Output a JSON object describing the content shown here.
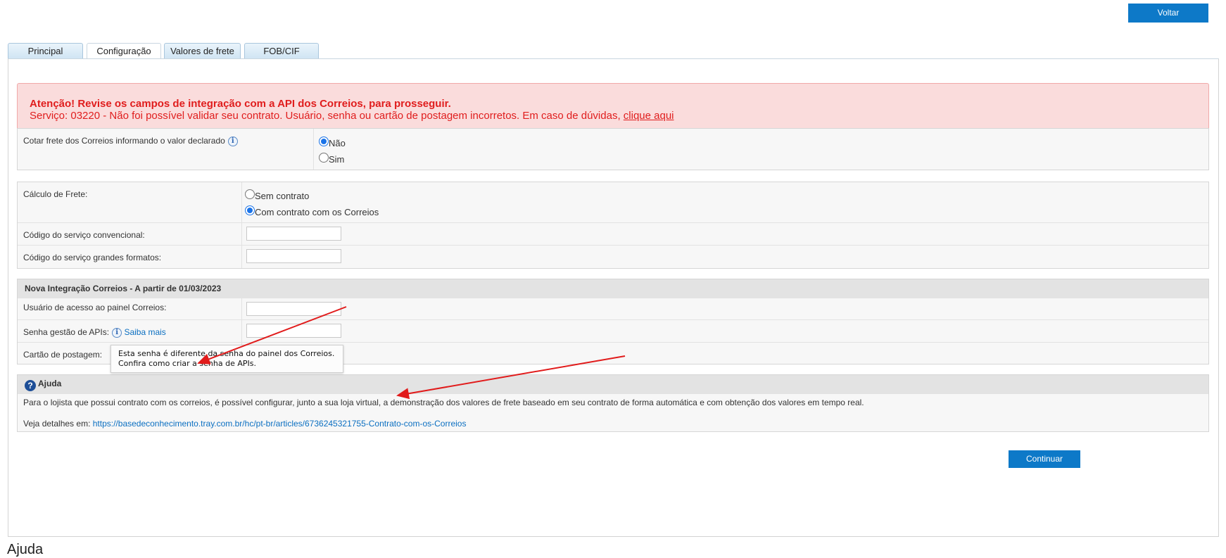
{
  "header": {
    "back_label": "Voltar"
  },
  "tabs": [
    {
      "label": "Principal"
    },
    {
      "label": "Configuração",
      "active": true
    },
    {
      "label": "Valores de frete"
    },
    {
      "label": "FOB/CIF"
    }
  ],
  "alert": {
    "title": "Atenção! Revise os campos de integração com a API dos Correios, para prosseguir.",
    "detail": "Serviço: 03220 - Não foi possível validar seu contrato. Usuário, senha ou cartão de postagem incorretos. Em caso de dúvidas, ",
    "link_label": "clique aqui"
  },
  "declared_value": {
    "label": "Cotar frete dos Correios informando o valor declarado",
    "options": [
      {
        "label": "Não",
        "selected": true
      },
      {
        "label": "Sim",
        "selected": false
      }
    ]
  },
  "freight": {
    "calc_label": "Cálculo de Frete:",
    "options": [
      {
        "label": "Sem contrato",
        "selected": false
      },
      {
        "label": "Com contrato com os Correios",
        "selected": true
      }
    ],
    "conventional_label": "Código do serviço convencional:",
    "conventional_value": "",
    "large_label": "Código do serviço grandes formatos:",
    "large_value": ""
  },
  "integration": {
    "title": "Nova Integração Correios - A partir de 01/03/2023",
    "user_label": "Usuário de acesso ao painel Correios:",
    "user_value": "",
    "password_label": "Senha gestão de APIs:",
    "learn_more": "Saiba mais",
    "password_value": "",
    "card_label": "Cartão de postagem:",
    "card_value": ""
  },
  "tooltip": {
    "line1": "Esta senha é diferente da senha do painel dos Correios.",
    "line2": "Confira como criar a senha de APIs."
  },
  "help": {
    "title": "Ajuda",
    "text": "Para o lojista que possui contrato com os correios, é possível configurar, junto a sua loja virtual, a demonstração dos valores de frete baseado em seu contrato de forma automática e com obtenção dos valores em tempo real.",
    "details_label": "Veja detalhes em:",
    "details_link": "https://basedeconhecimento.tray.com.br/hc/pt-br/articles/6736245321755-Contrato-com-os-Correios"
  },
  "footer": {
    "continue_label": "Continuar",
    "bottom_title": "Ajuda"
  },
  "colors": {
    "primary": "#0d79c8",
    "alert_text": "#e01d1d",
    "alert_bg": "#fadcdc",
    "arrow": "#e11b1b"
  }
}
